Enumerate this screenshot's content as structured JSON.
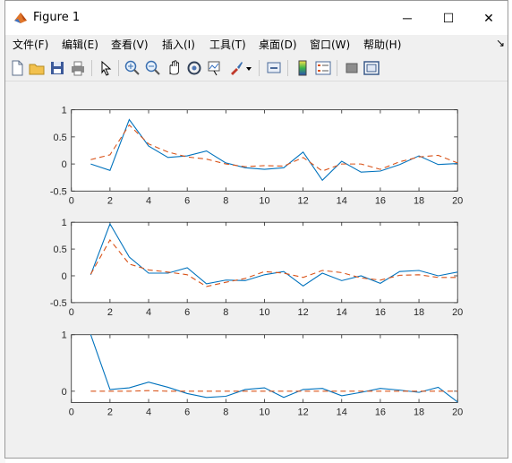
{
  "window": {
    "title": "Figure 1"
  },
  "window_controls": {
    "minimize": "─",
    "maximize": "☐",
    "close": "✕"
  },
  "menu": {
    "items": [
      "文件(F)",
      "编辑(E)",
      "查看(V)",
      "插入(I)",
      "工具(T)",
      "桌面(D)",
      "窗口(W)",
      "帮助(H)"
    ],
    "dock_glyph": "↘"
  },
  "toolbar": {
    "icons": [
      "new-figure-icon",
      "open-file-icon",
      "save-icon",
      "print-icon",
      "pointer-icon",
      "zoom-in-icon",
      "zoom-out-icon",
      "pan-icon",
      "rotate-3d-icon",
      "data-cursor-icon",
      "brush-icon",
      "brush-dropdown-icon",
      "link-plot-icon",
      "colorbar-icon",
      "legend-icon",
      "hide-plot-tools-icon",
      "show-plot-tools-icon"
    ]
  },
  "colors": {
    "series_solid": "#0072bd",
    "series_dashed": "#d95319",
    "window_bg": "#f0f0f0",
    "axes_bg": "#ffffff"
  },
  "chart_data": [
    {
      "type": "line",
      "x": [
        1,
        2,
        3,
        4,
        5,
        6,
        7,
        8,
        9,
        10,
        11,
        12,
        13,
        14,
        15,
        16,
        17,
        18,
        19,
        20
      ],
      "xlim": [
        0,
        20
      ],
      "ylim": [
        -0.5,
        1
      ],
      "xticks": [
        0,
        2,
        4,
        6,
        8,
        10,
        12,
        14,
        16,
        18,
        20
      ],
      "yticks": [
        -0.5,
        0,
        0.5,
        1
      ],
      "series": [
        {
          "style": "solid",
          "values": [
            0.0,
            -0.12,
            0.82,
            0.33,
            0.12,
            0.15,
            0.24,
            0.02,
            -0.07,
            -0.1,
            -0.07,
            0.22,
            -0.3,
            0.05,
            -0.15,
            -0.13,
            -0.01,
            0.15,
            -0.01,
            0.01
          ]
        },
        {
          "style": "dashed",
          "values": [
            0.08,
            0.17,
            0.72,
            0.37,
            0.22,
            0.13,
            0.09,
            0.0,
            -0.05,
            -0.03,
            -0.04,
            0.12,
            -0.13,
            0.0,
            0.0,
            -0.1,
            0.04,
            0.13,
            0.16,
            0.02
          ]
        }
      ]
    },
    {
      "type": "line",
      "x": [
        1,
        2,
        3,
        4,
        5,
        6,
        7,
        8,
        9,
        10,
        11,
        12,
        13,
        14,
        15,
        16,
        17,
        18,
        19,
        20
      ],
      "xlim": [
        0,
        20
      ],
      "ylim": [
        -0.5,
        1
      ],
      "xticks": [
        0,
        2,
        4,
        6,
        8,
        10,
        12,
        14,
        16,
        18,
        20
      ],
      "yticks": [
        -0.5,
        0,
        0.5,
        1
      ],
      "series": [
        {
          "style": "solid",
          "values": [
            0.02,
            0.97,
            0.35,
            0.05,
            0.05,
            0.15,
            -0.15,
            -0.08,
            -0.09,
            0.02,
            0.08,
            -0.19,
            0.05,
            -0.09,
            0.0,
            -0.14,
            0.08,
            0.1,
            0.0,
            0.07
          ]
        },
        {
          "style": "dashed",
          "values": [
            0.03,
            0.67,
            0.22,
            0.11,
            0.07,
            0.02,
            -0.2,
            -0.12,
            -0.05,
            0.08,
            0.05,
            -0.03,
            0.1,
            0.06,
            -0.04,
            -0.08,
            0.01,
            0.02,
            -0.03,
            -0.03
          ]
        }
      ]
    },
    {
      "type": "line",
      "x": [
        1,
        2,
        3,
        4,
        5,
        6,
        7,
        8,
        9,
        10,
        11,
        12,
        13,
        14,
        15,
        16,
        17,
        18,
        19,
        20
      ],
      "xlim": [
        0,
        20
      ],
      "ylim": [
        -0.2,
        1
      ],
      "xticks": [
        0,
        2,
        4,
        6,
        8,
        10,
        12,
        14,
        16,
        18,
        20
      ],
      "yticks": [
        0,
        1
      ],
      "series": [
        {
          "style": "solid",
          "values": [
            1.0,
            0.03,
            0.06,
            0.16,
            0.07,
            -0.04,
            -0.11,
            -0.09,
            0.03,
            0.06,
            -0.11,
            0.03,
            0.05,
            -0.08,
            -0.02,
            0.05,
            0.02,
            -0.02,
            0.07,
            -0.19
          ]
        },
        {
          "style": "dashed",
          "values": [
            0.0,
            0.0,
            0.0,
            0.01,
            0.0,
            0.0,
            0.0,
            0.0,
            0.0,
            0.0,
            0.0,
            0.0,
            0.0,
            0.0,
            0.0,
            0.0,
            0.0,
            0.0,
            0.0,
            0.0
          ]
        }
      ]
    }
  ]
}
